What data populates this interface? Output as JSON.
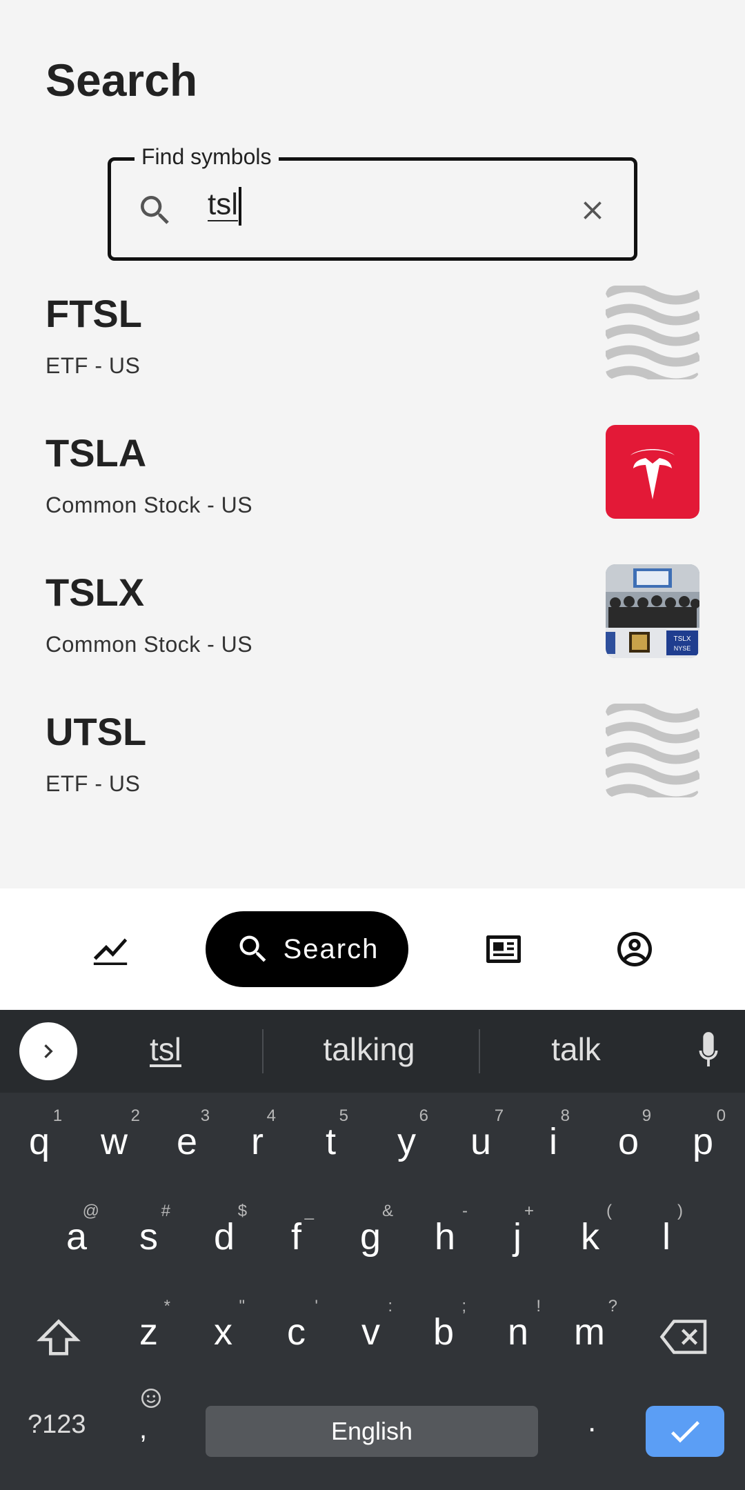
{
  "page": {
    "title": "Search"
  },
  "search": {
    "legend": "Find symbols",
    "value": "tsl"
  },
  "results": [
    {
      "symbol": "FTSL",
      "desc": "ETF - US",
      "thumb": "waves"
    },
    {
      "symbol": "TSLA",
      "desc": "Common Stock - US",
      "thumb": "tesla-logo"
    },
    {
      "symbol": "TSLX",
      "desc": "Common Stock - US",
      "thumb": "photo"
    },
    {
      "symbol": "UTSL",
      "desc": "ETF - US",
      "thumb": "waves"
    }
  ],
  "nav": {
    "search_label": "Search"
  },
  "keyboard": {
    "suggestions": [
      "tsl",
      "talking",
      "talk"
    ],
    "row1": [
      "q",
      "w",
      "e",
      "r",
      "t",
      "y",
      "u",
      "i",
      "o",
      "p"
    ],
    "row1_hints": [
      "1",
      "2",
      "3",
      "4",
      "5",
      "6",
      "7",
      "8",
      "9",
      "0"
    ],
    "row2": [
      "a",
      "s",
      "d",
      "f",
      "g",
      "h",
      "j",
      "k",
      "l"
    ],
    "row2_hints": [
      "@",
      "#",
      "$",
      "_",
      "&",
      "-",
      "+",
      "(",
      ")"
    ],
    "row3": [
      "z",
      "x",
      "c",
      "v",
      "b",
      "n",
      "m"
    ],
    "row3_hints": [
      "*",
      "\"",
      "'",
      ":",
      ";",
      "!",
      "?"
    ],
    "symbols_label": "?123",
    "comma": ",",
    "space_label": "English",
    "period": "."
  },
  "colors": {
    "accent": "#5b9ef5",
    "tesla_red": "#e31937",
    "nav_active": "#000000"
  }
}
